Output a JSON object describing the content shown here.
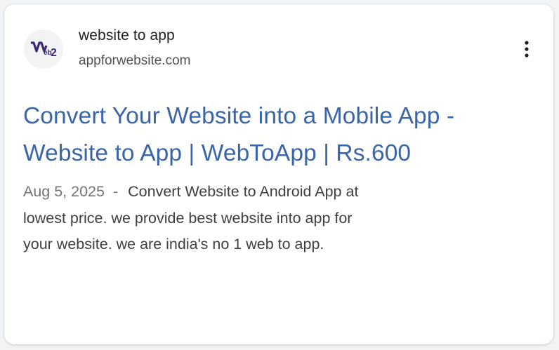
{
  "result": {
    "site_name": "website to app",
    "site_url": "appforwebsite.com",
    "favicon_icon": "web2-logo",
    "favicon_text": "Web2",
    "menu_icon": "more-vert-icon",
    "title": "Convert Your Website into a Mobile App - Website to App | WebToApp | Rs.600",
    "date": "Aug 5, 2025",
    "separator": "-",
    "snippet": "Convert Website to Android App at lowest price. we provide best website into app for your website. we are india's no 1 web to app.",
    "colors": {
      "title_link": "#3a65a8",
      "logo_purple": "#3b2a73"
    }
  }
}
